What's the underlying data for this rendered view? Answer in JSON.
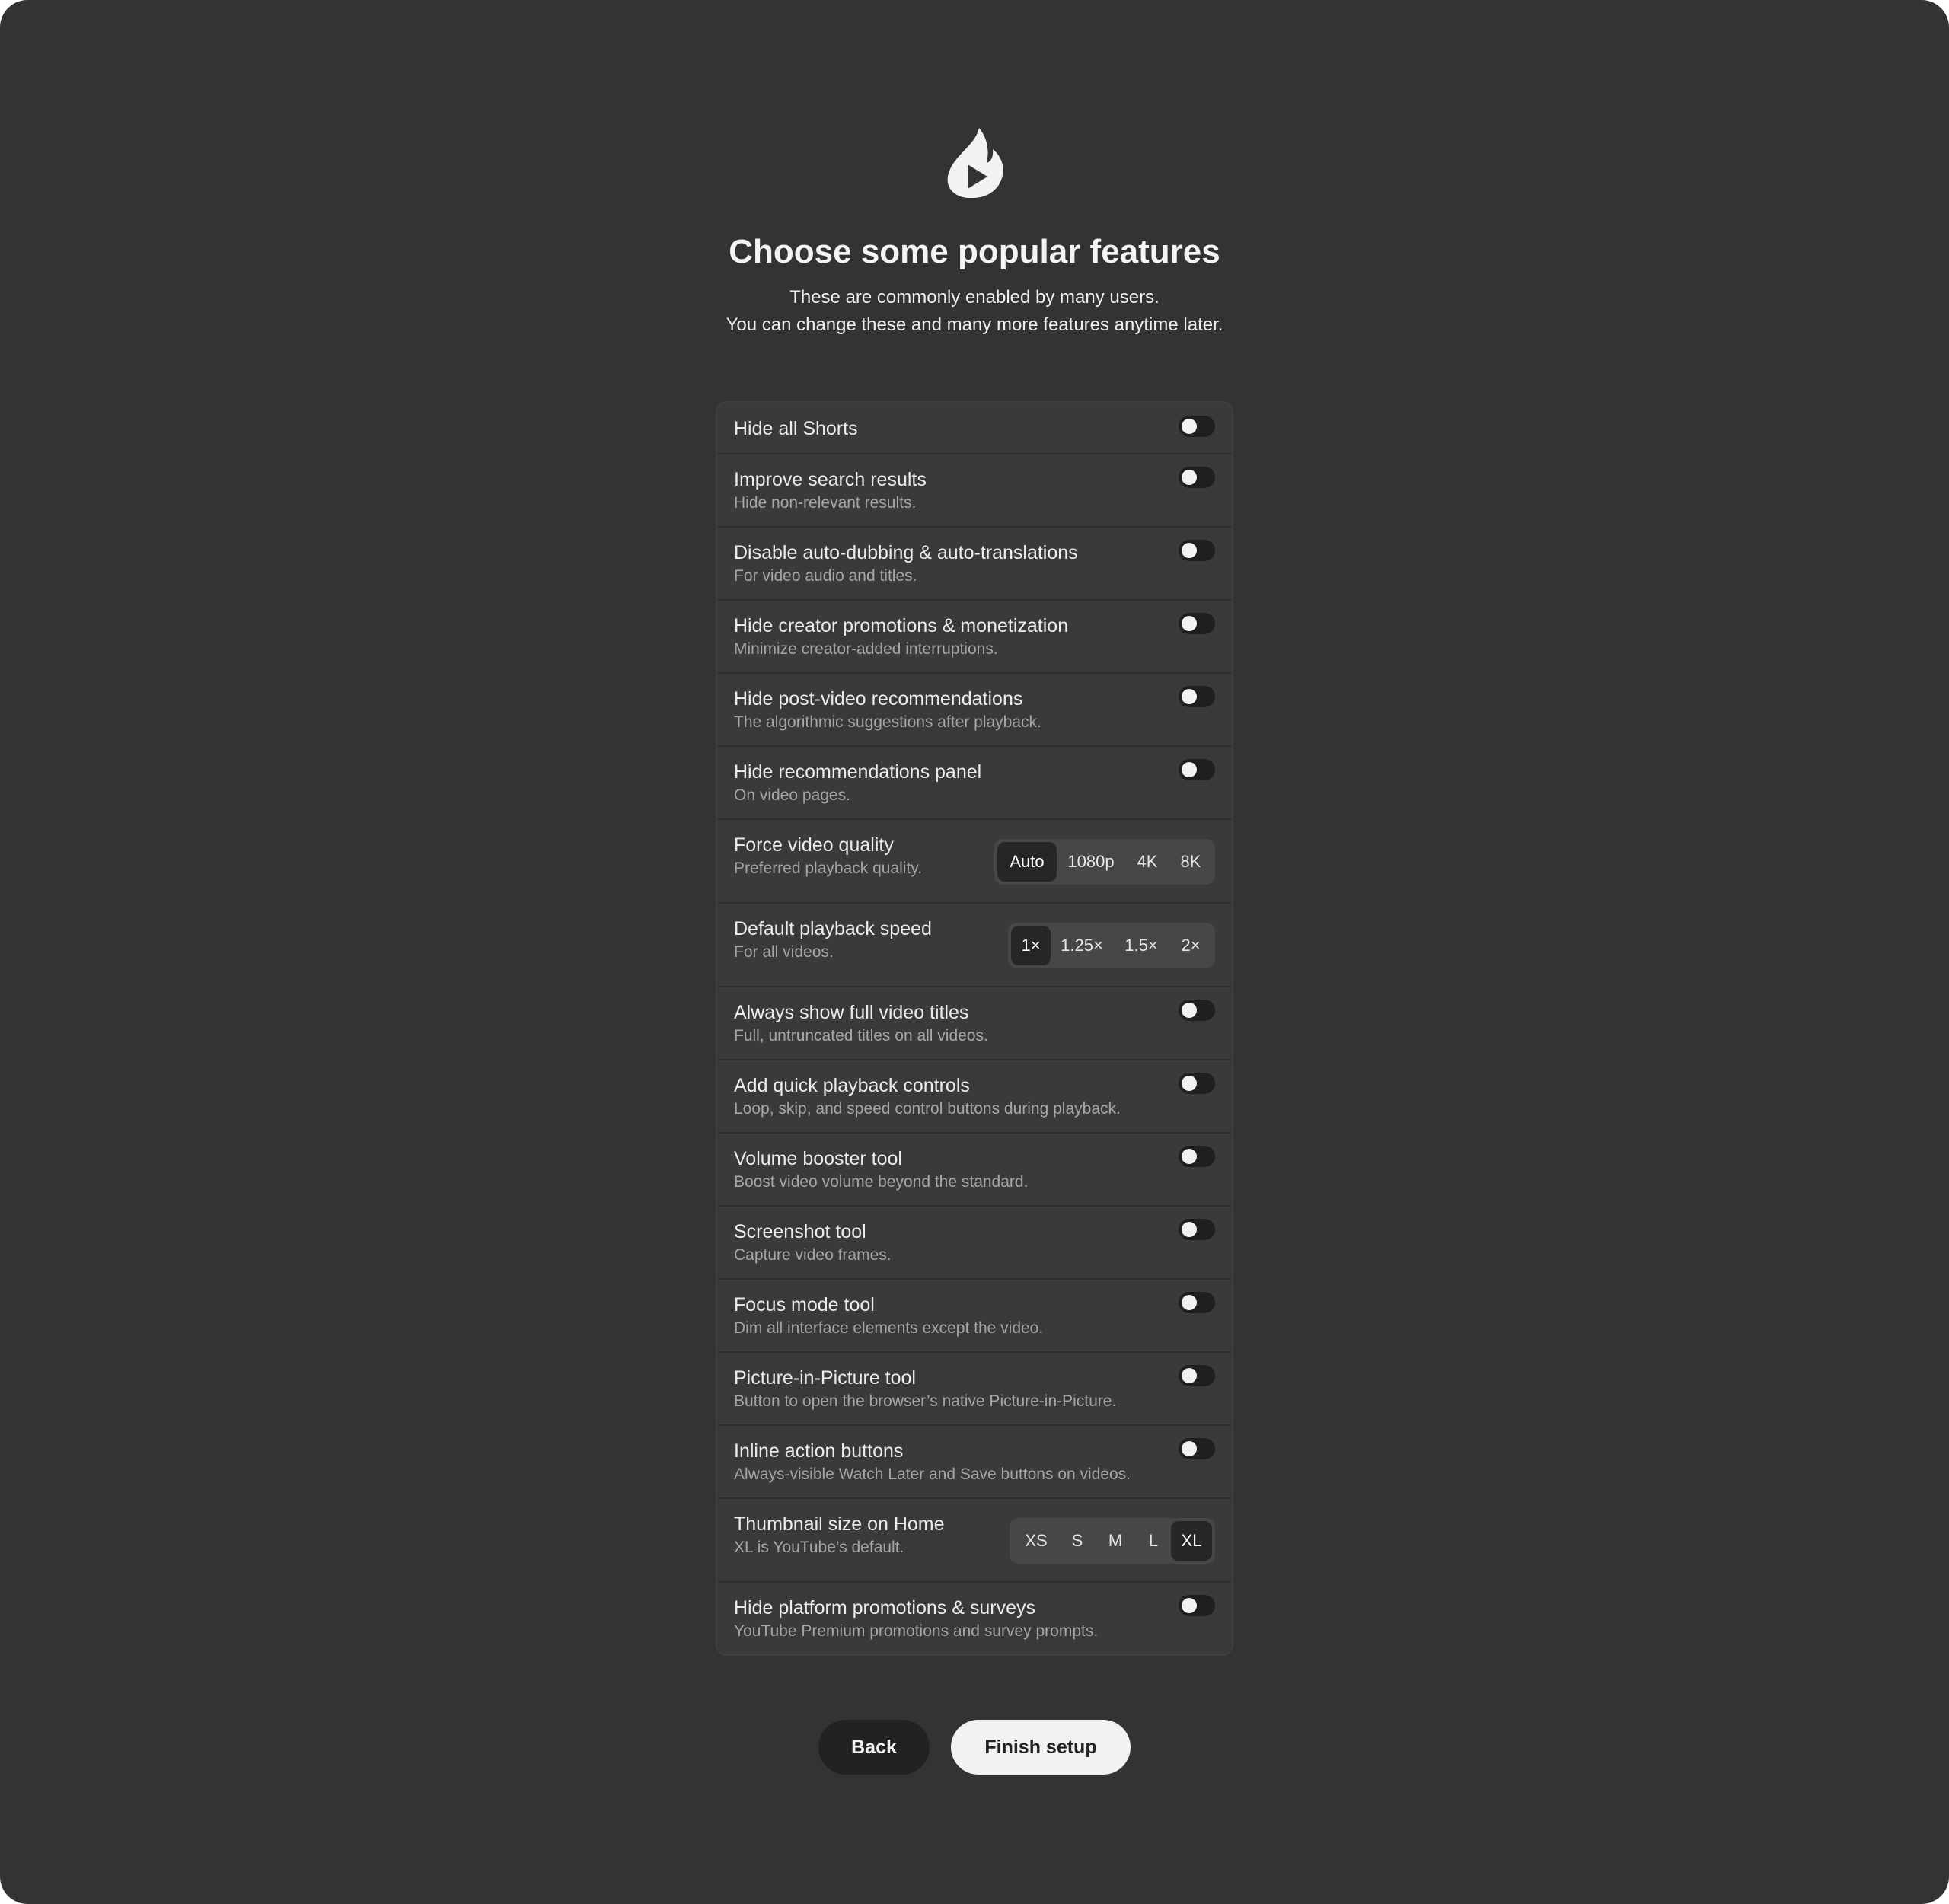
{
  "header": {
    "logo_icon": "flame-play-icon",
    "title": "Choose some popular features",
    "subtitle_line1": "These are commonly enabled by many users.",
    "subtitle_line2": "You can change these and many more features anytime later."
  },
  "features": {
    "hide_shorts": {
      "label": "Hide all Shorts",
      "enabled": false
    },
    "improve_search": {
      "label": "Improve search results",
      "description": "Hide non-relevant results.",
      "enabled": false
    },
    "disable_autodub": {
      "label": "Disable auto-dubbing & auto-translations",
      "description": "For video audio and titles.",
      "enabled": false
    },
    "hide_creator_promos": {
      "label": "Hide creator promotions & monetization",
      "description": "Minimize creator-added interruptions.",
      "enabled": false
    },
    "hide_post_video": {
      "label": "Hide post-video recommendations",
      "description": "The algorithmic suggestions after playback.",
      "enabled": false
    },
    "hide_rec_panel": {
      "label": "Hide recommendations panel",
      "description": "On video pages.",
      "enabled": false
    },
    "video_quality": {
      "label": "Force video quality",
      "description": "Preferred playback quality.",
      "options": [
        "Auto",
        "1080p",
        "4K",
        "8K"
      ],
      "selected": "Auto"
    },
    "playback_speed": {
      "label": "Default playback speed",
      "description": "For all videos.",
      "options": [
        "1×",
        "1.25×",
        "1.5×",
        "2×"
      ],
      "selected": "1×"
    },
    "full_titles": {
      "label": "Always show full video titles",
      "description": "Full, untruncated titles on all videos.",
      "enabled": false
    },
    "quick_controls": {
      "label": "Add quick playback controls",
      "description": "Loop, skip, and speed control buttons during playback.",
      "enabled": false
    },
    "volume_booster": {
      "label": "Volume booster tool",
      "description": "Boost video volume beyond the standard.",
      "enabled": false
    },
    "screenshot_tool": {
      "label": "Screenshot tool",
      "description": "Capture video frames.",
      "enabled": false
    },
    "focus_mode": {
      "label": "Focus mode tool",
      "description": "Dim all interface elements except the video.",
      "enabled": false
    },
    "pip_tool": {
      "label": "Picture-in-Picture tool",
      "description": "Button to open the browser’s native Picture-in-Picture.",
      "enabled": false
    },
    "inline_actions": {
      "label": "Inline action buttons",
      "description": "Always-visible Watch Later and Save buttons on videos.",
      "enabled": false
    },
    "thumbnail_size": {
      "label": "Thumbnail size on Home",
      "description": "XL is YouTube’s default.",
      "options": [
        "XS",
        "S",
        "M",
        "L",
        "XL"
      ],
      "selected": "XL"
    },
    "hide_platform_promos": {
      "label": "Hide platform promotions & surveys",
      "description": "YouTube Premium promotions and survey prompts.",
      "enabled": false
    }
  },
  "footer": {
    "back_label": "Back",
    "finish_label": "Finish setup"
  },
  "colors": {
    "background": "#333333",
    "card": "#3a3a3a",
    "toggle_track": "#1f1f1f",
    "selected_segment": "#262626",
    "primary_button": "#f2f2f2"
  }
}
